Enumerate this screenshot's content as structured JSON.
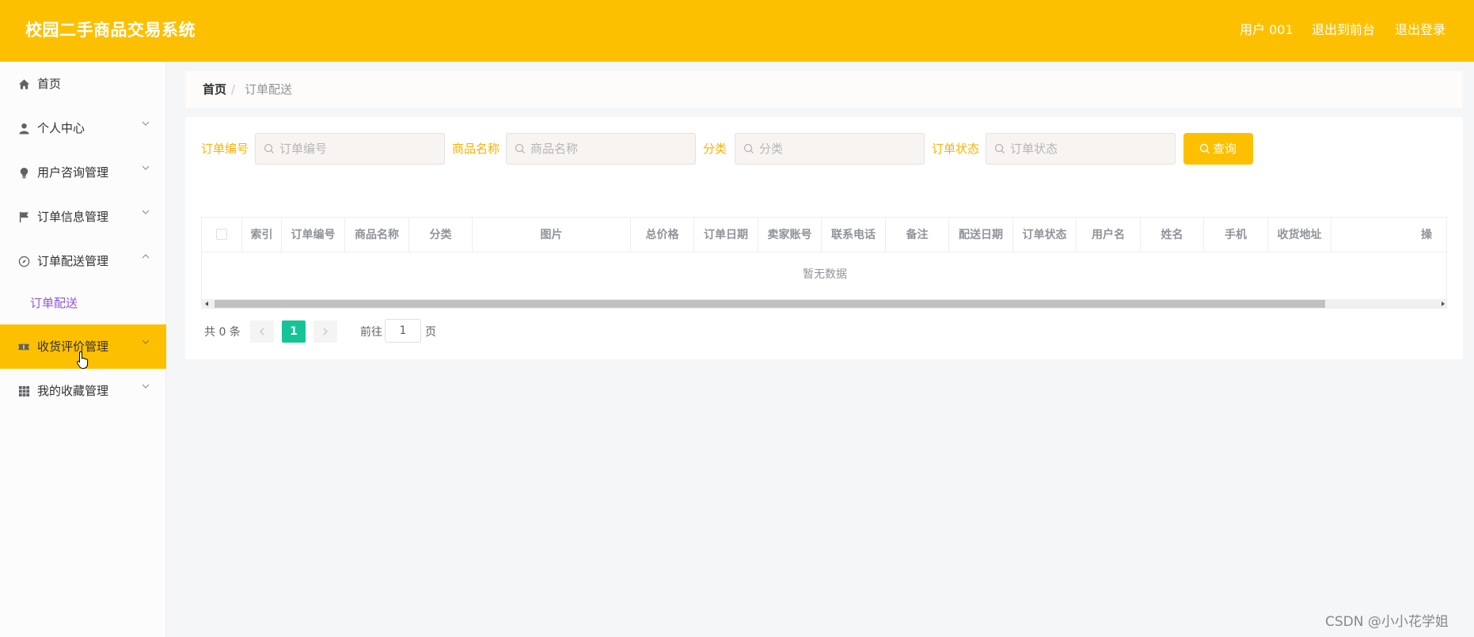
{
  "header": {
    "title": "校园二手商品交易系统",
    "user": "用户 001",
    "to_frontend": "退出到前台",
    "logout": "退出登录"
  },
  "sidebar": {
    "items": [
      {
        "label": "首页",
        "icon": "home-icon"
      },
      {
        "label": "个人中心",
        "icon": "user-icon"
      },
      {
        "label": "用户咨询管理",
        "icon": "lightbulb-icon"
      },
      {
        "label": "订单信息管理",
        "icon": "flag-icon"
      },
      {
        "label": "订单配送管理",
        "icon": "compass-icon",
        "expanded": true,
        "children": [
          {
            "label": "订单配送"
          }
        ]
      },
      {
        "label": "收货评价管理",
        "icon": "ticket-icon",
        "hovered": true
      },
      {
        "label": "我的收藏管理",
        "icon": "grid-icon"
      }
    ]
  },
  "breadcrumb": {
    "home": "首页",
    "separator": "/",
    "current": "订单配送"
  },
  "filters": [
    {
      "label": "订单编号",
      "placeholder": "订单编号"
    },
    {
      "label": "商品名称",
      "placeholder": "商品名称"
    },
    {
      "label": "分类",
      "placeholder": "分类"
    },
    {
      "label": "订单状态",
      "placeholder": "订单状态"
    }
  ],
  "query_button": "查询",
  "table": {
    "columns": [
      "索引",
      "订单编号",
      "商品名称",
      "分类",
      "图片",
      "总价格",
      "订单日期",
      "卖家账号",
      "联系电话",
      "备注",
      "配送日期",
      "订单状态",
      "用户名",
      "姓名",
      "手机",
      "收货地址",
      "操"
    ],
    "empty_text": "暂无数据"
  },
  "pagination": {
    "total_text": "共 0 条",
    "current_page": "1",
    "goto_label": "前往",
    "goto_value": "1",
    "page_suffix": "页"
  },
  "watermark": "CSDN @小小花学姐",
  "colors": {
    "primary": "#fdc000",
    "active_page": "#14c497",
    "submenu_active": "#9254de",
    "filter_label": "#fdb100"
  }
}
